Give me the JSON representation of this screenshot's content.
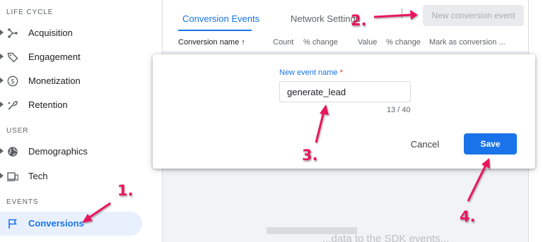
{
  "sidebar": {
    "sections": {
      "life_cycle": "LIFE CYCLE",
      "user": "USER",
      "events": "EVENTS"
    },
    "items": [
      {
        "label": "Acquisition",
        "icon": "acquisition-icon"
      },
      {
        "label": "Engagement",
        "icon": "tag-icon"
      },
      {
        "label": "Monetization",
        "icon": "dollar-circle-icon"
      },
      {
        "label": "Retention",
        "icon": "retention-icon"
      },
      {
        "label": "Demographics",
        "icon": "globe-icon"
      },
      {
        "label": "Tech",
        "icon": "devices-icon"
      },
      {
        "label": "Conversions",
        "icon": "flag-icon",
        "active": true
      }
    ]
  },
  "tabs": {
    "conversion_events": "Conversion Events",
    "network_settings": "Network Settings"
  },
  "toolbar": {
    "new_conversion_event": "New conversion event"
  },
  "table": {
    "columns": {
      "conversion_name": "Conversion name ↑",
      "count": "Count",
      "count_change": "% change",
      "value": "Value",
      "value_change": "% change",
      "mark_as_conversion": "Mark as conversion ..."
    }
  },
  "background_text": "...data to the SDK events...",
  "dialog": {
    "label": "New event name",
    "required_mark": "*",
    "value": "generate_lead",
    "char_count": "13 / 40",
    "cancel": "Cancel",
    "save": "Save"
  },
  "annotations": {
    "step1": "1.",
    "step2": "2.",
    "step3": "3.",
    "step4": "4."
  },
  "colors": {
    "accent": "#1a73e8",
    "annotation": "#e8175d",
    "active_nav_bg": "#e8f0fe"
  }
}
